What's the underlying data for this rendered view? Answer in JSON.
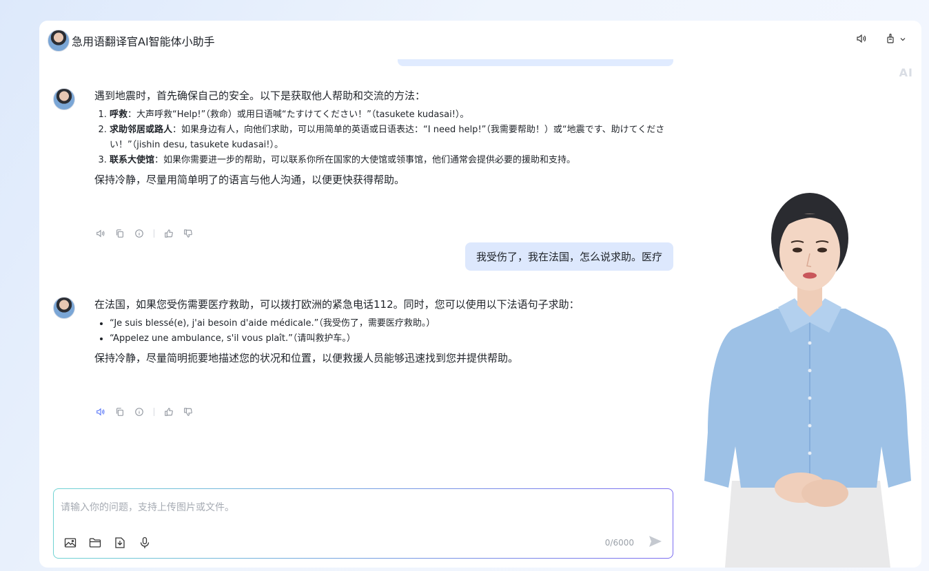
{
  "header": {
    "title": "急用语翻译官AI智能体小助手",
    "ai_mark": "AI"
  },
  "messages": {
    "bot1": {
      "intro": "遇到地震时，首先确保自己的安全。以下是获取他人帮助和交流的方法：",
      "items": [
        {
          "bold": "呼救",
          "text": "：大声呼救“Help!”（救命）或用日语喊“たすけてください！”（tasukete kudasai!）。"
        },
        {
          "bold": "求助邻居或路人",
          "text": "：如果身边有人，向他们求助，可以用简单的英语或日语表达：“I need help!”（我需要帮助！）或“地震です、助けてください！”（jishin desu, tasukete kudasai!）。"
        },
        {
          "bold": "联系大使馆",
          "text": "：如果你需要进一步的帮助，可以联系你所在国家的大使馆或领事馆，他们通常会提供必要的援助和支持。"
        }
      ],
      "outro": "保持冷静，尽量用简单明了的语言与他人沟通，以便更快获得帮助。"
    },
    "user1": {
      "text": "我受伤了，我在法国，怎么说求助。医疗"
    },
    "bot2": {
      "intro": "在法国，如果您受伤需要医疗救助，可以拨打欧洲的紧急电话112。同时，您可以使用以下法语句子求助：",
      "items": [
        "“Je suis blessé(e), j'ai besoin d'aide médicale.”（我受伤了，需要医疗救助。）",
        "“Appelez une ambulance, s'il vous plaît.”（请叫救护车。）"
      ],
      "outro": "保持冷静，尽量简明扼要地描述您的状况和位置，以便救援人员能够迅速找到您并提供帮助。"
    }
  },
  "input": {
    "placeholder": "请输入你的问题，支持上传图片或文件。",
    "value": "",
    "counter": "0/6000"
  },
  "icons": {
    "header": [
      "speaker-icon",
      "touch-icon",
      "chevron-down-icon"
    ],
    "message_actions": [
      "speaker-icon",
      "copy-icon",
      "info-icon",
      "thumbs-up-icon",
      "thumbs-down-icon"
    ],
    "input_tools": [
      "image-icon",
      "folder-icon",
      "file-icon",
      "microphone-icon"
    ],
    "send": "send-icon"
  },
  "colors": {
    "accent": "#4f6ef7",
    "user_bubble": "#dde8fd",
    "input_border_start": "#6fd3d3",
    "input_border_end": "#7a6cf0"
  }
}
